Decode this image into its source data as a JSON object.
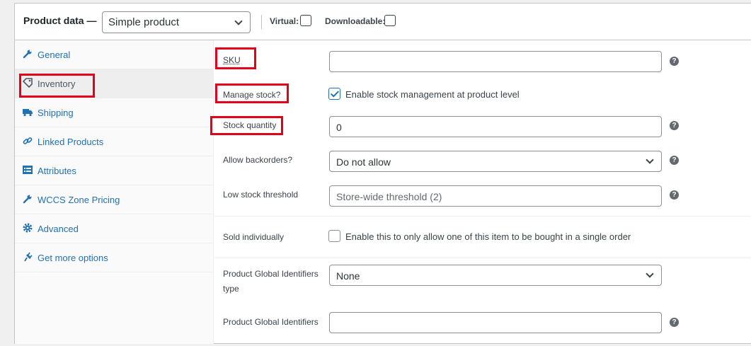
{
  "header": {
    "title": "Product data —",
    "product_type": "Simple product",
    "virtual_label": "Virtual:",
    "downloadable_label": "Downloadable:"
  },
  "sidebar": {
    "items": [
      {
        "label": "General",
        "icon": "wrench-icon"
      },
      {
        "label": "Inventory",
        "icon": "tag-icon",
        "active": true
      },
      {
        "label": "Shipping",
        "icon": "truck-icon"
      },
      {
        "label": "Linked Products",
        "icon": "link-icon"
      },
      {
        "label": "Attributes",
        "icon": "list-icon"
      },
      {
        "label": "WCCS Zone Pricing",
        "icon": "wrench-icon"
      },
      {
        "label": "Advanced",
        "icon": "gear-icon"
      },
      {
        "label": "Get more options",
        "icon": "plugin-icon"
      }
    ]
  },
  "inventory": {
    "sku_label": "SKU",
    "sku_value": "",
    "manage_stock_label": "Manage stock?",
    "manage_stock_text": "Enable stock management at product level",
    "manage_stock_checked": true,
    "stock_qty_label": "Stock quantity",
    "stock_qty_value": "0",
    "backorders_label": "Allow backorders?",
    "backorders_value": "Do not allow",
    "low_stock_label": "Low stock threshold",
    "low_stock_placeholder": "Store-wide threshold (2)",
    "sold_individually_label": "Sold individually",
    "sold_individually_text": "Enable this to only allow one of this item to be bought in a single order",
    "sold_individually_checked": false,
    "gid_type_label_line1": "Product Global Identifiers",
    "gid_type_label_line2": "type",
    "gid_type_value": "None",
    "gid_label": "Product Global Identifiers",
    "gid_value": ""
  },
  "colors": {
    "highlight": "#e2001a",
    "link": "#2271b1"
  }
}
